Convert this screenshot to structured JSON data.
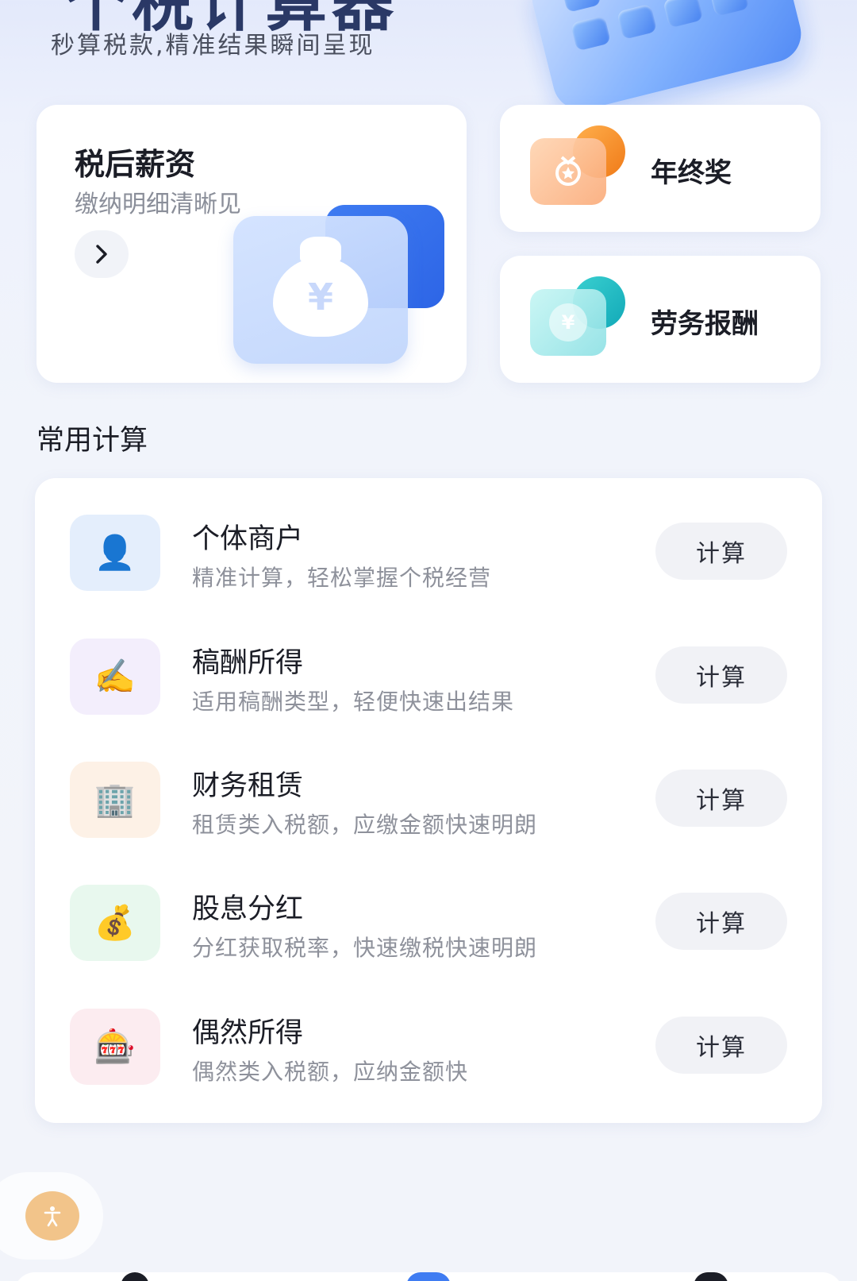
{
  "header": {
    "title": "个税计算器",
    "subtitle": "秒算税款,精准结果瞬间呈现"
  },
  "featured": {
    "salary": {
      "title": "税后薪资",
      "subtitle": "缴纳明细清晰见",
      "bag_symbol": "¥"
    },
    "year_end_bonus": {
      "label": "年终奖"
    },
    "labor": {
      "label": "劳务报酬",
      "symbol": "¥"
    }
  },
  "section": {
    "title": "常用计算"
  },
  "calculators": [
    {
      "title": "个体商户",
      "desc": "精准计算，轻松掌握个税经营",
      "emoji": "👤",
      "button": "计算",
      "tint": "#e4eefc"
    },
    {
      "title": "稿酬所得",
      "desc": "适用稿酬类型，轻便快速出结果",
      "emoji": "✍️",
      "button": "计算",
      "tint": "#f3eefc"
    },
    {
      "title": "财务租赁",
      "desc": "租赁类入税额，应缴金额快速明朗",
      "emoji": "🏢",
      "button": "计算",
      "tint": "#fdf1e6"
    },
    {
      "title": "股息分红",
      "desc": "分红获取税率，快速缴税快速明朗",
      "emoji": "💰",
      "button": "计算",
      "tint": "#e8f8ee"
    },
    {
      "title": "偶然所得",
      "desc": "偶然类入税额，应纳金额快",
      "emoji": "🎰",
      "button": "计算",
      "tint": "#fcecf0"
    }
  ],
  "colors": {
    "accent_blue": "#3f7cf2",
    "orange": "#f07a18",
    "teal": "#12a9b8",
    "a11y": "#f2c48a"
  },
  "icons": {
    "arrow": "chevron-right-icon",
    "a11y": "accessibility-icon"
  }
}
